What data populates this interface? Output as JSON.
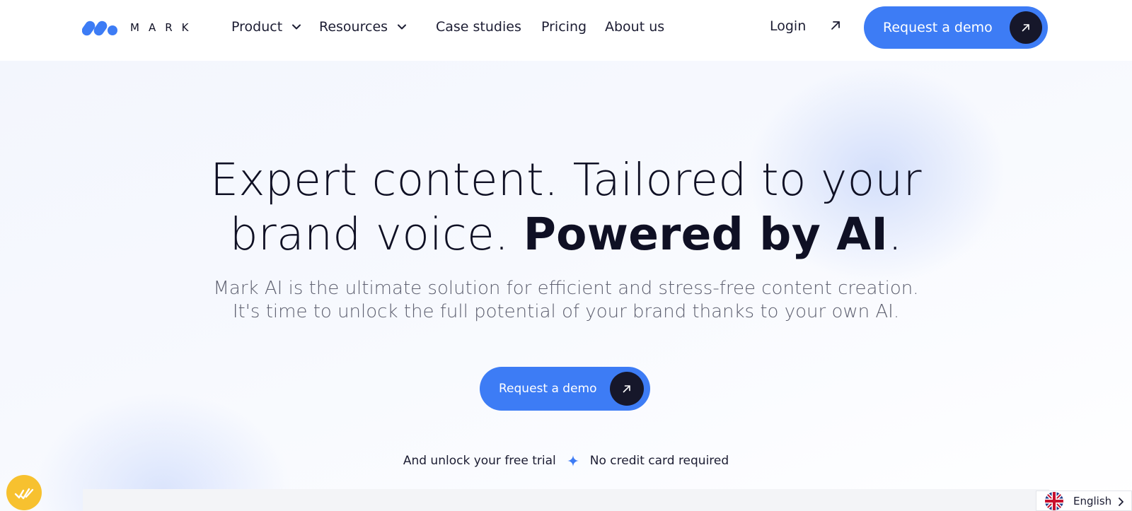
{
  "brand": {
    "name": "MARK",
    "accent": "#3d7cf5",
    "dark": "#16172a"
  },
  "nav": {
    "items": [
      {
        "label": "Product",
        "dropdown": true
      },
      {
        "label": "Resources",
        "dropdown": true
      },
      {
        "label": "Case studies",
        "dropdown": false
      },
      {
        "label": "Pricing",
        "dropdown": false
      },
      {
        "label": "About us",
        "dropdown": false
      }
    ],
    "login_label": "Login",
    "cta_label": "Request a demo"
  },
  "hero": {
    "title_line1": "Expert content. Tailored to your",
    "title_line2_light": "brand voice. ",
    "title_line2_bold": "Powered by AI",
    "title_line2_end": ".",
    "subtitle_line1": "Mark AI is the ultimate solution for efficient and stress-free content creation.",
    "subtitle_line2": "It's time to unlock the full potential of your brand thanks to your own AI.",
    "cta_label": "Request a demo",
    "trial_text": "And unlock your free trial",
    "no_card_text": "No credit card required"
  },
  "language": {
    "label": "English",
    "flag_icon": "uk-flag-icon"
  },
  "icons": {
    "arrow": "arrow-up-right-icon",
    "chevron": "chevron-down-icon",
    "sparkle": "sparkle-icon",
    "widget": "checkmarks-widget-icon"
  }
}
